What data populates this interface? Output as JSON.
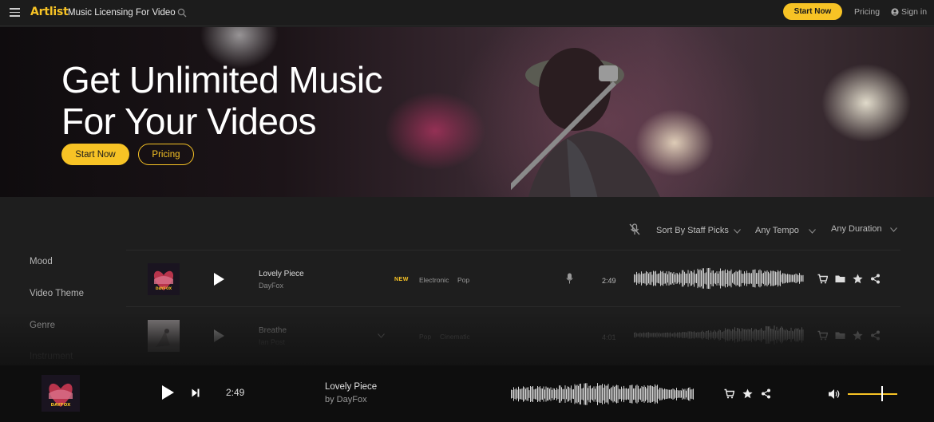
{
  "nav": {
    "logo": "Artlist",
    "title": "Music Licensing For Video",
    "start_label": "Start Now",
    "pricing_label": "Pricing",
    "signin_label": "Sign in"
  },
  "hero": {
    "title_line1": "Get Unlimited Music",
    "title_line2": "For Your Videos",
    "start_label": "Start Now",
    "pricing_label": "Pricing"
  },
  "filters": {
    "sort": "Sort By Staff Picks",
    "tempo": "Any Tempo",
    "duration": "Any Duration"
  },
  "sidebar": {
    "items": [
      "Mood",
      "Video Theme",
      "Genre",
      "Instrument"
    ]
  },
  "tracks": [
    {
      "title": "Lovely Piece",
      "artist": "DayFox",
      "badge": "NEW",
      "tags": [
        "Electronic",
        "Pop"
      ],
      "duration": "2:49"
    },
    {
      "title": "Breathe",
      "artist": "Ian Post",
      "badge": "",
      "tags": [
        "Pop",
        "Cinematic"
      ],
      "duration": "4:01"
    }
  ],
  "player": {
    "time": "2:49",
    "title": "Lovely Piece",
    "artist": "by DayFox",
    "volume": 0.68
  },
  "art_text": {
    "track1": "DAYFOX",
    "player": "DAYFOX"
  },
  "icons": [
    "menu-icon",
    "search-icon",
    "user-icon",
    "mic-off-icon",
    "chevron-down-icon",
    "play-icon",
    "mic-icon",
    "cart-icon",
    "folder-icon",
    "star-icon",
    "share-icon",
    "next-icon",
    "volume-icon"
  ],
  "colors": {
    "accent": "#f7c325",
    "background": "#1e1e1e",
    "nav": "#1c1c1c",
    "player": "#0e0e0e"
  }
}
